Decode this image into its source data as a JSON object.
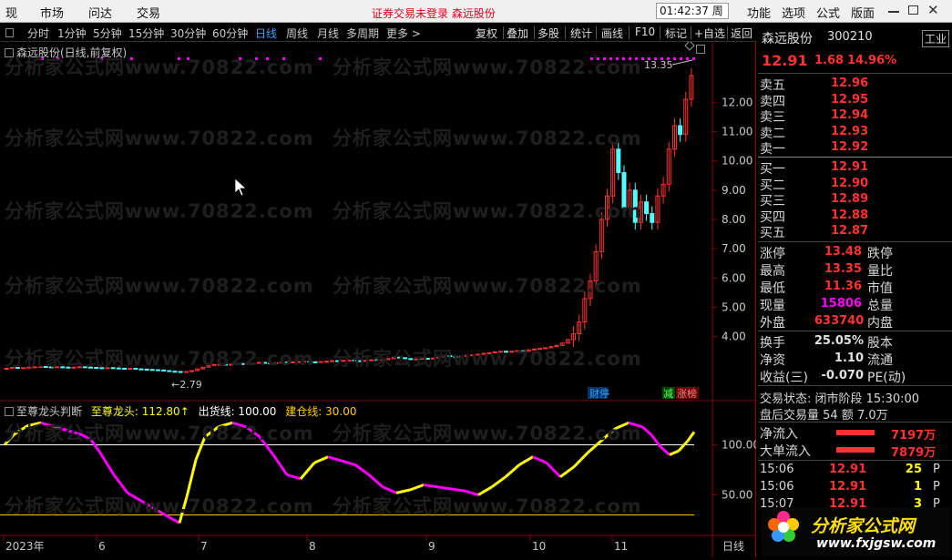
{
  "menu": {
    "items": [
      "现",
      "市场",
      "问达",
      "交易"
    ],
    "right": [
      "功能",
      "选项",
      "公式",
      "版面"
    ],
    "notice": "证券交易未登录  森远股份",
    "clock": "01:42:37 周一"
  },
  "periods": [
    "分时",
    "1分钟",
    "5分钟",
    "15分钟",
    "30分钟",
    "60分钟",
    "日线",
    "周线",
    "月线",
    "多周期",
    "更多 >"
  ],
  "tools": [
    "复权",
    "叠加",
    "多股",
    "统计",
    "画线",
    "F10",
    "标记",
    "+自选",
    "返回"
  ],
  "stock_head": "森远股份(日线,前复权)",
  "watermark": "分析家公式网www.70822.com",
  "indicator": {
    "name": "至尊龙头判断",
    "t1": "至尊龙头: 112.80↑",
    "t2": "出货线: 100.00",
    "t3": "建仓线: 30.00"
  },
  "price_axis": [
    "12.00",
    "11.00",
    "10.00",
    "9.00",
    "8.00",
    "7.00",
    "6.00",
    "5.00",
    "4.00"
  ],
  "ind_axis": [
    "100.00",
    "50.00"
  ],
  "date_axis": [
    "2023年",
    "6",
    "7",
    "8",
    "9",
    "10",
    "11"
  ],
  "period_label": "日线",
  "annotations": {
    "high": "13.35",
    "low": "2.79"
  },
  "flags": [
    "财停",
    "减",
    "涨榜"
  ],
  "quote": {
    "name": "森远股份",
    "code": "300210",
    "tag": "工业",
    "price": "12.91",
    "change": "1.68",
    "pct": "14.96%",
    "sell": [
      [
        "卖五",
        "12.96"
      ],
      [
        "卖四",
        "12.95"
      ],
      [
        "卖三",
        "12.94"
      ],
      [
        "卖二",
        "12.93"
      ],
      [
        "卖一",
        "12.92"
      ]
    ],
    "buy": [
      [
        "买一",
        "12.91"
      ],
      [
        "买二",
        "12.90"
      ],
      [
        "买三",
        "12.89"
      ],
      [
        "买四",
        "12.88"
      ],
      [
        "买五",
        "12.87"
      ]
    ],
    "stats": [
      [
        "涨停",
        "13.48",
        "跌停"
      ],
      [
        "最高",
        "13.35",
        "量比"
      ],
      [
        "最低",
        "11.36",
        "市值"
      ],
      [
        "现量",
        "15806",
        "总量"
      ],
      [
        "外盘",
        "633740",
        "内盘"
      ]
    ],
    "stats2": [
      [
        "换手",
        "25.05%",
        "股本"
      ],
      [
        "净资",
        "1.10",
        "流通"
      ],
      [
        "收益(三)",
        "-0.070",
        "PE(动)"
      ]
    ],
    "status": "交易状态: 闭市阶段 15:30:00",
    "after": "盘后交易量 54 额 7.0万",
    "flow": [
      [
        "净流入",
        "7197万"
      ],
      [
        "大单流入",
        "7879万"
      ]
    ],
    "ticks": [
      [
        "15:06",
        "12.91",
        "25",
        "P"
      ],
      [
        "15:06",
        "12.91",
        "1",
        "P"
      ],
      [
        "15:07",
        "12.91",
        "3",
        "P"
      ]
    ]
  },
  "logo": {
    "text": "分析家公式网",
    "url": "www.fxjgsw.com"
  },
  "colors": {
    "up": "#ff3232",
    "down": "#54ffff",
    "blue": "#3aa0ff",
    "yellow": "#ffff00",
    "magenta": "#ff00ff"
  },
  "chart_data": {
    "type": "candlestick",
    "xlabel": "",
    "ylabel": "",
    "ylim": [
      2.5,
      13.5
    ],
    "dates_shown": [
      "2023年",
      "6",
      "7",
      "8",
      "9",
      "10",
      "11"
    ],
    "closes": [
      2.92,
      2.95,
      2.93,
      2.94,
      2.96,
      2.97,
      2.98,
      2.97,
      2.96,
      2.97,
      2.96,
      2.95,
      2.96,
      2.97,
      2.96,
      2.95,
      2.94,
      2.93,
      2.94,
      2.93,
      2.92,
      2.91,
      2.92,
      2.9,
      2.89,
      2.88,
      2.87,
      2.86,
      2.84,
      2.82,
      2.81,
      2.8,
      2.81,
      2.84,
      2.9,
      2.96,
      3.02,
      3.05,
      3.06,
      3.05,
      3.06,
      3.08,
      3.07,
      3.09,
      3.1,
      3.12,
      3.1,
      3.08,
      3.11,
      3.13,
      3.12,
      3.14,
      3.15,
      3.16,
      3.14,
      3.13,
      3.15,
      3.16,
      3.18,
      3.17,
      3.19,
      3.2,
      3.18,
      3.17,
      3.19,
      3.21,
      3.2,
      3.22,
      3.25,
      3.3,
      3.28,
      3.25,
      3.22,
      3.24,
      3.26,
      3.25,
      3.27,
      3.3,
      3.35,
      3.32,
      3.3,
      3.33,
      3.36,
      3.38,
      3.4,
      3.43,
      3.45,
      3.48,
      3.5,
      3.48,
      3.5,
      3.52,
      3.5,
      3.55,
      3.58,
      3.6,
      3.62,
      3.66,
      3.7,
      3.78,
      3.9,
      4.1,
      4.5,
      5.3,
      5.9,
      6.9,
      8.0,
      8.8,
      10.4,
      9.6,
      8.4,
      9.0,
      7.9,
      8.6,
      8.2,
      7.9,
      8.8,
      9.2,
      10.4,
      11.2,
      10.9,
      12.1,
      12.91
    ],
    "indicator": {
      "name": "至尊龙头",
      "last": 112.8,
      "sell_line": 100,
      "build_line": 30
    }
  }
}
